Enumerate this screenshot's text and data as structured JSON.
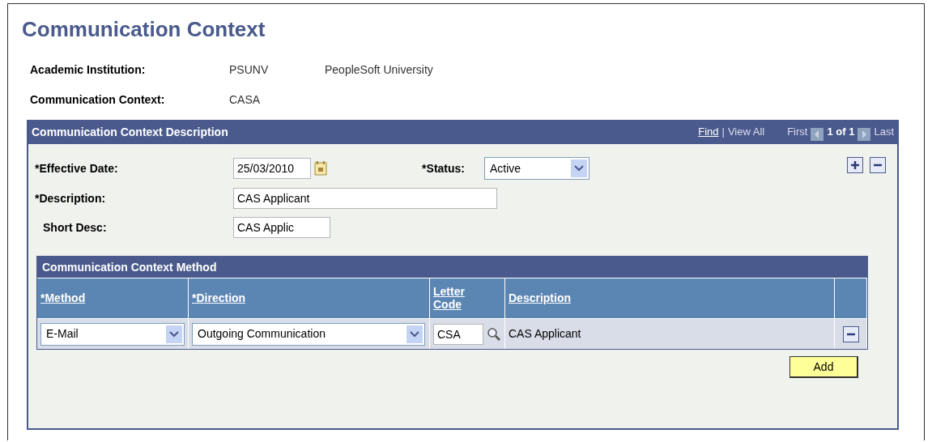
{
  "title": "Communication Context",
  "header_fields": [
    {
      "label": "Academic Institution:",
      "values": [
        "PSUNV",
        "PeopleSoft University"
      ]
    },
    {
      "label": "Communication Context:",
      "values": [
        "CASA"
      ]
    }
  ],
  "panel": {
    "title": "Communication Context Description",
    "nav": {
      "find": "Find",
      "separator": "|",
      "view_all": "View All",
      "first": "First",
      "count": "1 of 1",
      "last": "Last"
    },
    "effective_date": {
      "label": "*Effective Date:",
      "value": "25/03/2010"
    },
    "status": {
      "label": "*Status:",
      "value": "Active"
    },
    "description": {
      "label": "*Description:",
      "value": "CAS Applicant"
    },
    "short_desc": {
      "label": "Short Desc:",
      "value": "CAS Applic"
    },
    "grid": {
      "title": "Communication Context Method",
      "columns": [
        "*Method",
        "*Direction",
        "Letter Code",
        "Description"
      ],
      "rows": [
        {
          "method": "E-Mail",
          "direction": "Outgoing Communication",
          "letter_code": "CSA",
          "description": "CAS Applicant"
        }
      ],
      "add_button": "Add"
    }
  }
}
